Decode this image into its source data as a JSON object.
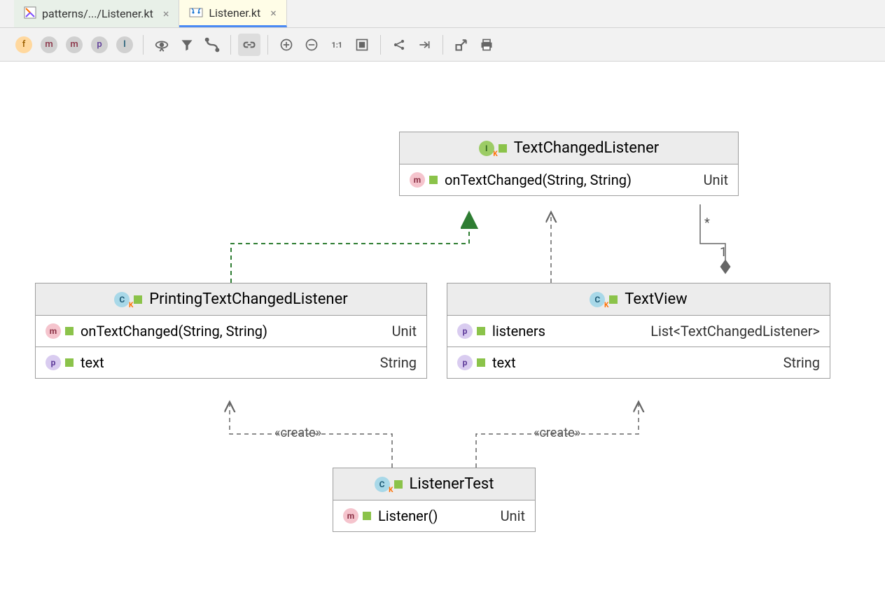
{
  "tabs": [
    {
      "label": "patterns/.../Listener.kt",
      "active": false
    },
    {
      "label": "Listener.kt",
      "active": true
    }
  ],
  "toolbar_filters": [
    "f",
    "m",
    "m",
    "p",
    "I"
  ],
  "classes": {
    "textChangedListener": {
      "name": "TextChangedListener",
      "kind": "interface",
      "members": [
        {
          "icon": "m",
          "name": "onTextChanged(String, String)",
          "type": "Unit"
        }
      ]
    },
    "printingTextChangedListener": {
      "name": "PrintingTextChangedListener",
      "kind": "class",
      "members": [
        {
          "icon": "m",
          "name": "onTextChanged(String, String)",
          "type": "Unit"
        },
        {
          "icon": "p",
          "name": "text",
          "type": "String"
        }
      ]
    },
    "textView": {
      "name": "TextView",
      "kind": "class",
      "members": [
        {
          "icon": "p",
          "name": "listeners",
          "type": "List<TextChangedListener>"
        },
        {
          "icon": "p",
          "name": "text",
          "type": "String"
        }
      ]
    },
    "listenerTest": {
      "name": "ListenerTest",
      "kind": "class",
      "members": [
        {
          "icon": "m",
          "name": "Listener()",
          "type": "Unit"
        }
      ]
    }
  },
  "relations": {
    "create1": "«create»",
    "create2": "«create»",
    "multStar": "*",
    "multOne": "1"
  }
}
